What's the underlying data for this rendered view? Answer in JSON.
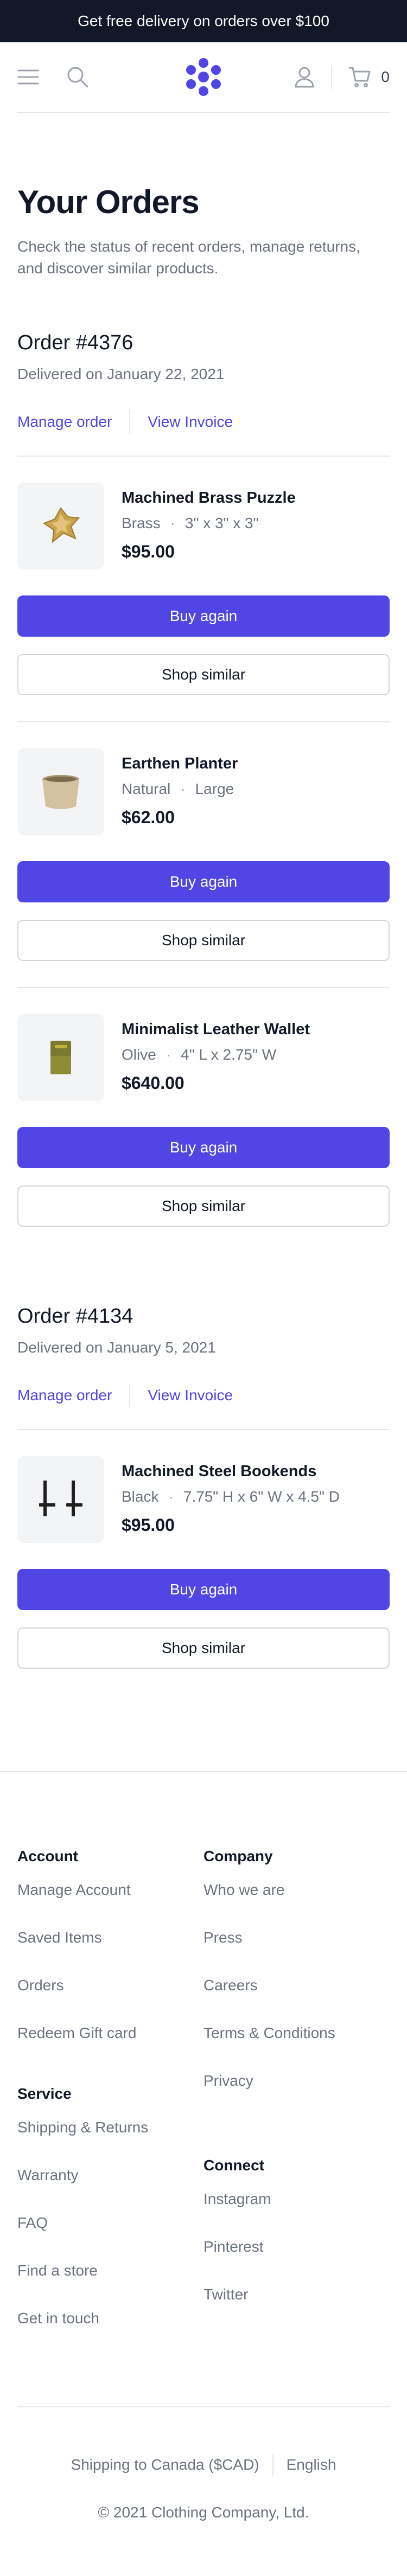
{
  "promo": {
    "text": "Get free delivery on orders over $100"
  },
  "nav": {
    "menu_icon": "menu-icon",
    "search_icon": "search-icon",
    "logo_icon": "asterisk-logo-icon",
    "account_icon": "user-icon",
    "cart_icon": "shopping-cart-icon",
    "cart_count": "0"
  },
  "page": {
    "title": "Your Orders",
    "subtitle": "Check the status of recent orders, manage returns, and discover similar products."
  },
  "colors": {
    "accent": "#4f46e5",
    "dark": "#111827",
    "muted": "#6b7280",
    "border": "#e5e7eb"
  },
  "orders": [
    {
      "number": "Order #4376",
      "date": "Delivered on January 22, 2021",
      "manage_label": "Manage order",
      "invoice_label": "View Invoice",
      "items": [
        {
          "name": "Machined Brass Puzzle",
          "variant": "Brass",
          "size": "3\" x 3\" x 3\"",
          "price": "$95.00",
          "buy_label": "Buy again",
          "shop_label": "Shop similar"
        },
        {
          "name": "Earthen Planter",
          "variant": "Natural",
          "size": "Large",
          "price": "$62.00",
          "buy_label": "Buy again",
          "shop_label": "Shop similar"
        },
        {
          "name": "Minimalist Leather Wallet",
          "variant": "Olive",
          "size": "4\" L x 2.75\" W",
          "price": "$640.00",
          "buy_label": "Buy again",
          "shop_label": "Shop similar"
        }
      ]
    },
    {
      "number": "Order #4134",
      "date": "Delivered on January 5, 2021",
      "manage_label": "Manage order",
      "invoice_label": "View Invoice",
      "items": [
        {
          "name": "Machined Steel Bookends",
          "variant": "Black",
          "size": "7.75\" H x 6\" W x 4.5\" D",
          "price": "$95.00",
          "buy_label": "Buy again",
          "shop_label": "Shop similar"
        }
      ]
    }
  ],
  "footer": {
    "account": {
      "heading": "Account",
      "links": [
        "Manage Account",
        "Saved Items",
        "Orders",
        "Redeem Gift card"
      ]
    },
    "service": {
      "heading": "Service",
      "links": [
        "Shipping & Returns",
        "Warranty",
        "FAQ",
        "Find a store",
        "Get in touch"
      ]
    },
    "company": {
      "heading": "Company",
      "links": [
        "Who we are",
        "Press",
        "Careers",
        "Terms & Conditions",
        "Privacy"
      ]
    },
    "connect": {
      "heading": "Connect",
      "links": [
        "Instagram",
        "Pinterest",
        "Twitter"
      ]
    },
    "shipping": "Shipping to Canada ($CAD)",
    "language": "English",
    "copyright": "© 2021 Clothing Company, Ltd."
  }
}
